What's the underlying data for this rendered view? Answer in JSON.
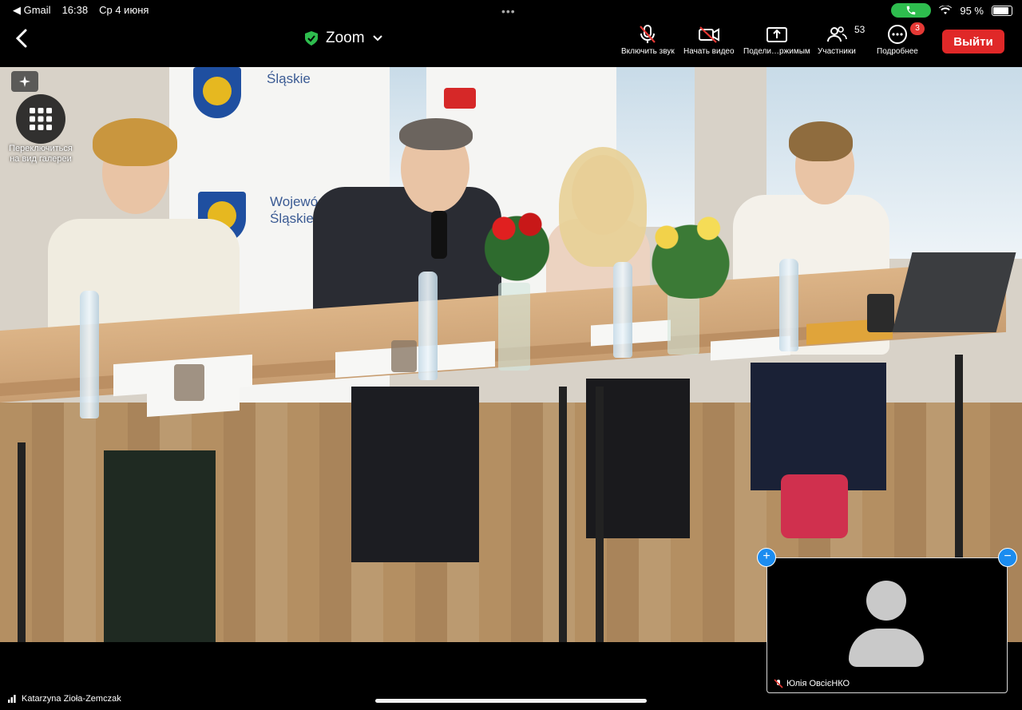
{
  "status_bar": {
    "back_app": "◀ Gmail",
    "time": "16:38",
    "date": "Ср 4 июня",
    "battery": "95 %"
  },
  "toolbar": {
    "app_title": "Zoom",
    "buttons": [
      {
        "label": "Включить звук",
        "icon": "microphone-muted-icon"
      },
      {
        "label": "Начать видео",
        "icon": "video-off-icon"
      },
      {
        "label": "Подели…ржимым",
        "icon": "share-screen-icon"
      },
      {
        "label": "Участники",
        "icon": "participants-icon",
        "count": "53"
      },
      {
        "label": "Подробнее",
        "icon": "more-icon",
        "badge": "3"
      }
    ],
    "leave_label": "Выйти"
  },
  "video": {
    "gallery_label": "Переключиться на вид галереи",
    "banner_left": "Województwo\nŚląskie",
    "banner_left_top": "Śląskie"
  },
  "self_view": {
    "name": "Юлія ОвсієНКО"
  },
  "active_speaker": {
    "name": "Katarzyna Zioła-Zemczak"
  },
  "colors": {
    "leave": "#e02828",
    "accent": "#1b8cf0",
    "call": "#2ebd4e",
    "shield": "#2ebd4e"
  }
}
